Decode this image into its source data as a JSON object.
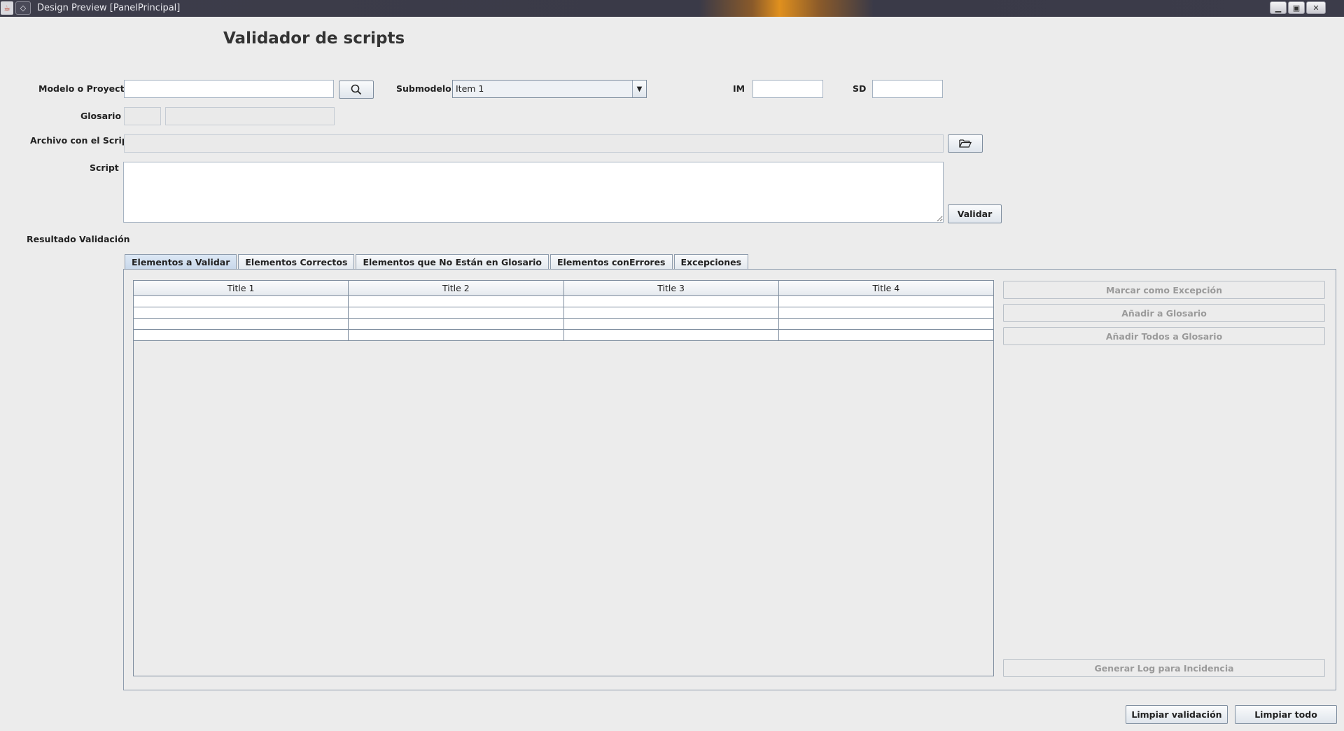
{
  "window": {
    "title": "Design Preview [PanelPrincipal]",
    "controls": [
      "minimize-icon",
      "restore-icon",
      "close-icon"
    ]
  },
  "header": {
    "title": "Validador de scripts"
  },
  "form": {
    "modelo_label": "Modelo o Proyecto",
    "modelo_value": "",
    "submodelo_label": "Submodelo",
    "submodelo_selected": "Item 1",
    "im_label": "IM",
    "im_value": "",
    "sd_label": "SD",
    "sd_value": "",
    "glosario_label": "Glosario",
    "archivo_label": "Archivo con el Script",
    "script_label": "Script",
    "script_value": "",
    "validar_label": "Validar",
    "resultado_label": "Resultado Validación"
  },
  "tabs": [
    {
      "label": "Elementos a Validar",
      "active": true
    },
    {
      "label": "Elementos Correctos",
      "active": false
    },
    {
      "label": "Elementos que No Están en Glosario",
      "active": false
    },
    {
      "label": "Elementos conErrores",
      "active": false
    },
    {
      "label": "Excepciones",
      "active": false
    }
  ],
  "table": {
    "columns": [
      "Title 1",
      "Title 2",
      "Title 3",
      "Title 4"
    ],
    "rows": [
      [
        "",
        "",
        "",
        ""
      ],
      [
        "",
        "",
        "",
        ""
      ],
      [
        "",
        "",
        "",
        ""
      ],
      [
        "",
        "",
        "",
        ""
      ]
    ]
  },
  "side_actions": {
    "marcar": "Marcar como Excepción",
    "anadir": "Añadir a Glosario",
    "anadir_todos": "Añadir Todos a Glosario",
    "generar_log": "Generar Log para Incidencia"
  },
  "footer": {
    "limpiar_validacion": "Limpiar validación",
    "limpiar_todo": "Limpiar todo"
  },
  "colors": {
    "background": "#ececec",
    "titlebar": "#3a3a48",
    "accent": "#e0901e",
    "active_tab": "#c7d7ea"
  }
}
